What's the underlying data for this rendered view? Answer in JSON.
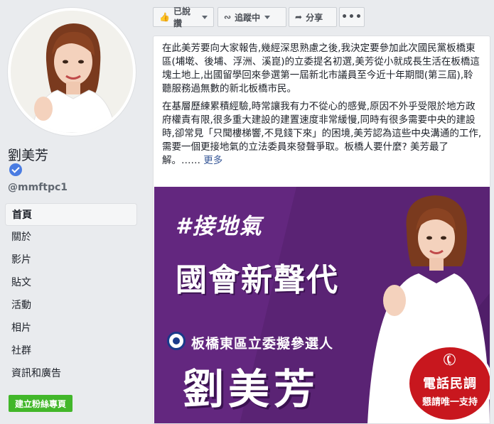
{
  "profile": {
    "name": "劉美芳",
    "handle": "@mmftpc1"
  },
  "nav": {
    "items": [
      {
        "label": "首頁",
        "active": true
      },
      {
        "label": "關於"
      },
      {
        "label": "影片"
      },
      {
        "label": "貼文"
      },
      {
        "label": "活動"
      },
      {
        "label": "相片"
      },
      {
        "label": "社群"
      },
      {
        "label": "資訊和廣告"
      }
    ],
    "create_page": "建立粉絲專頁"
  },
  "toolbar": {
    "like_label": "已說讚",
    "follow_label": "追蹤中",
    "share_label": "分享",
    "more_label": "•••"
  },
  "post": {
    "paragraph1": "在此美芳要向大家報告,幾經深思熟慮之後,我決定要參加此次國民黨板橋東區(埔墘、後埔、浮洲、溪崑)的立委提名初選,美芳從小就成長生活在板橋這塊土地上,出國留學回來參選第一屆新北市議員至今近十年期間(第三屆),聆聽服務過無數的新北板橋市民。",
    "paragraph2": "在基層歷練累積經驗,時常讓我有力不從心的感覺,原因不外乎受限於地方政府權責有限,很多重大建設的建置速度非常緩慢,同時有很多需要中央的建設時,卻常見「只聞樓梯響,不見錢下來」的困境,美芳認為這些中央溝通的工作,需要一個更接地氣的立法委員來發聲爭取。板橋人要什麼? 美芳最了解。……",
    "more_label": "更多"
  },
  "banner": {
    "hashtag": "#接地氣",
    "headline": "國會新聲代",
    "subtitle": "板橋東區立委擬參選人",
    "name": "劉美芳",
    "badge_title": "電話民調",
    "badge_sub": "懇請唯一支持",
    "colors": {
      "background": "#5a2374",
      "badge": "#c8171e"
    }
  }
}
